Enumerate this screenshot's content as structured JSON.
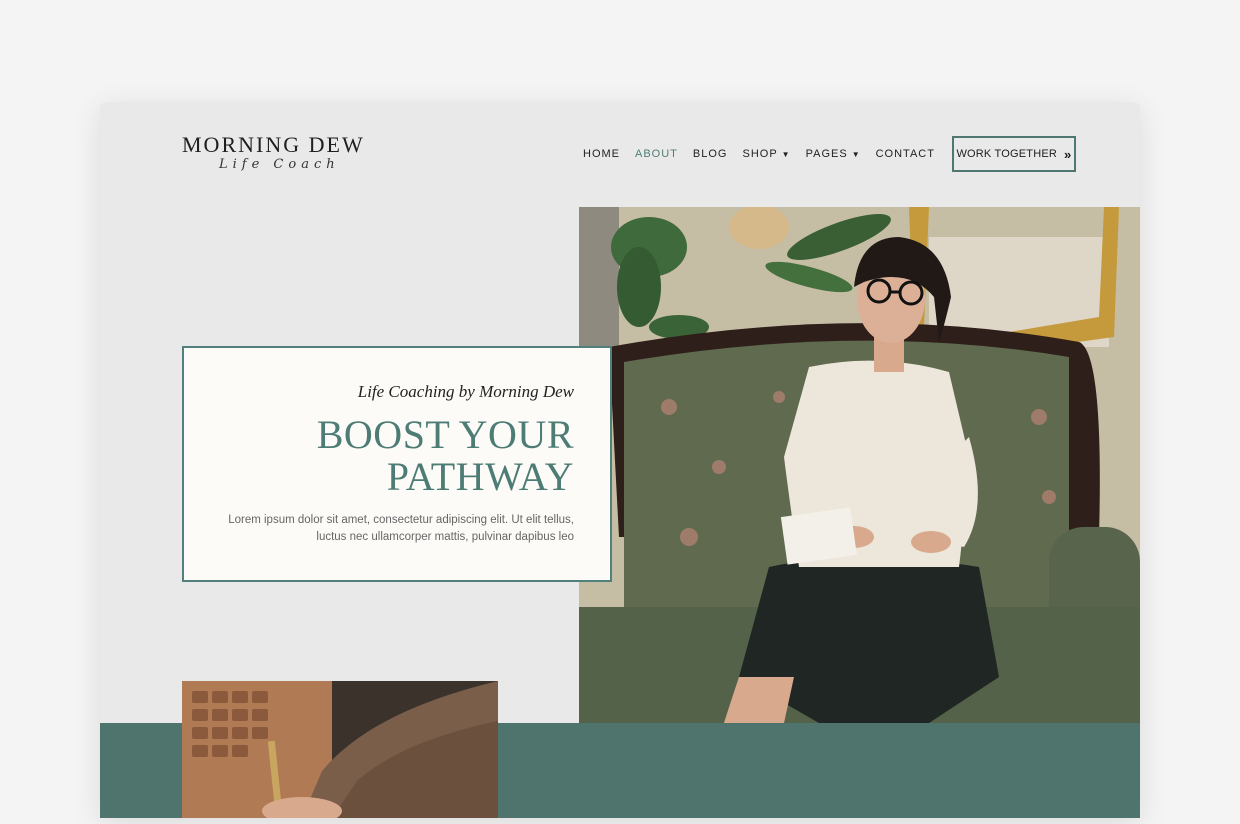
{
  "brand": {
    "name": "MORNING DEW",
    "tagline": "Life Coach"
  },
  "nav": {
    "items": [
      {
        "label": "HOME",
        "active": false,
        "dropdown": false
      },
      {
        "label": "ABOUT",
        "active": true,
        "dropdown": false
      },
      {
        "label": "BLOG",
        "active": false,
        "dropdown": false
      },
      {
        "label": "SHOP",
        "active": false,
        "dropdown": true
      },
      {
        "label": "PAGES",
        "active": false,
        "dropdown": true
      },
      {
        "label": "CONTACT",
        "active": false,
        "dropdown": false
      }
    ],
    "cta_label": "WORK TOGETHER",
    "cta_icon": "double-chevron-right-icon"
  },
  "hero": {
    "eyebrow": "Life Coaching by Morning Dew",
    "title_line1": "BOOST YOUR",
    "title_line2": "PATHWAY",
    "body_line1": "Lorem ipsum dolor sit amet, consectetur adipiscing elit. Ut elit tellus,",
    "body_line2": "luctus nec ullamcorper mattis, pulvinar dapibus leo"
  },
  "colors": {
    "accent": "#4f7d74",
    "band": "#4f746e",
    "card_bg": "#fdfbf8",
    "page_bg": "#e9e9e9"
  }
}
